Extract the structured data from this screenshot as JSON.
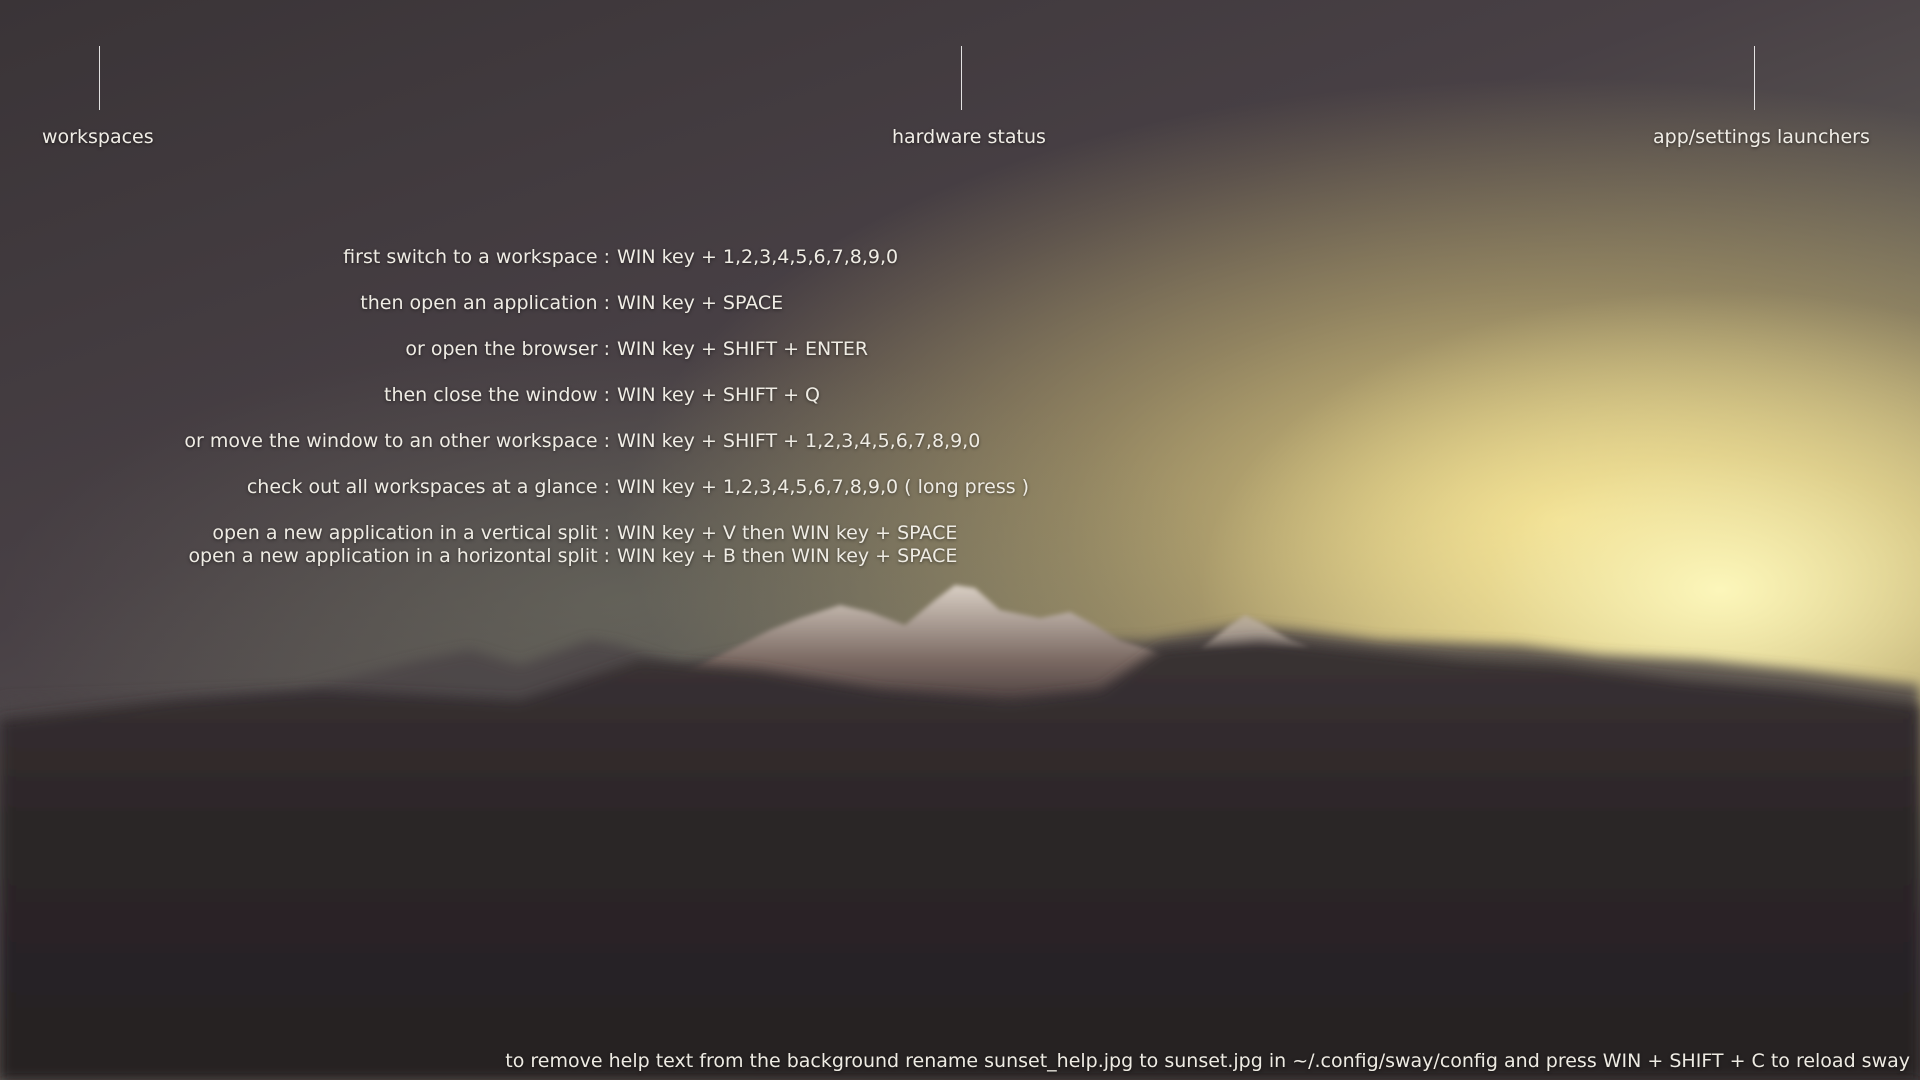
{
  "annotations": {
    "workspaces": "workspaces",
    "hardware_status": "hardware status",
    "launchers": "app/settings launchers"
  },
  "help": [
    {
      "desc": "first switch to a workspace :",
      "keys": "WIN key + 1,2,3,4,5,6,7,8,9,0"
    },
    {
      "desc": "then open an application :",
      "keys": "WIN key + SPACE"
    },
    {
      "desc": "or open the browser :",
      "keys": "WIN key + SHIFT + ENTER"
    },
    {
      "desc": "then close the window :",
      "keys": "WIN key + SHIFT + Q"
    },
    {
      "desc": "or move the window to an other workspace :",
      "keys": "WIN key + SHIFT + 1,2,3,4,5,6,7,8,9,0"
    },
    {
      "desc": "check out all workspaces at a glance :",
      "keys": "WIN key + 1,2,3,4,5,6,7,8,9,0 ( long press )"
    },
    {
      "desc": "open a new application in a vertical split :",
      "keys": "WIN key + V then WIN key + SPACE"
    },
    {
      "desc": "open a new application in a horizontal split :",
      "keys": "WIN key + B then WIN key + SPACE"
    }
  ],
  "footer": "to remove help text from the background rename sunset_help.jpg to sunset.jpg in ~/.config/sway/config and press WIN + SHIFT + C to reload sway",
  "colors": {
    "text": "#f0ede6",
    "sky_glow": "#fcefa8",
    "ground": "#2a2527"
  }
}
